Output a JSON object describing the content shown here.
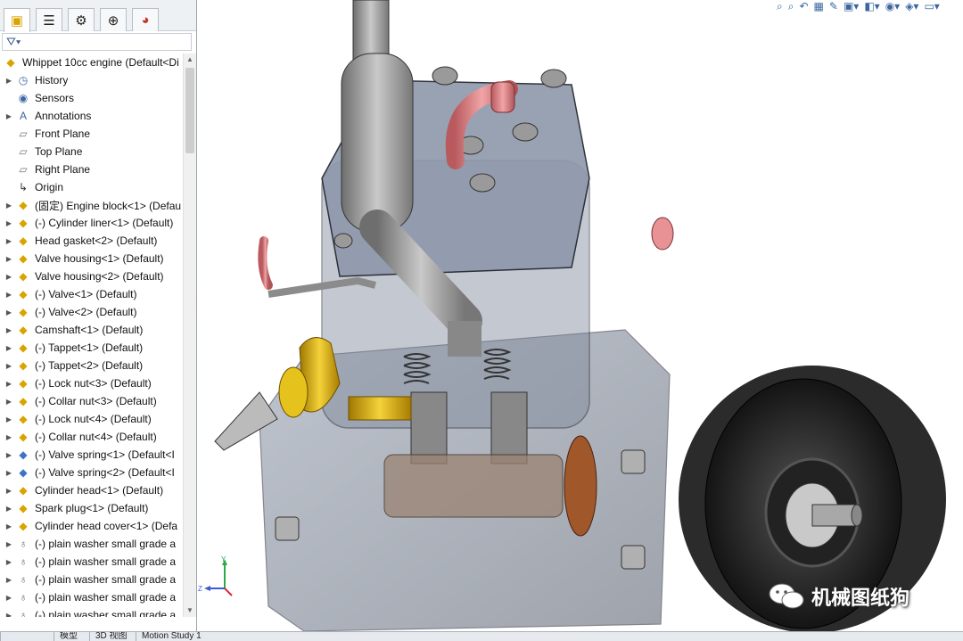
{
  "tabs": [
    {
      "icon": "feature-manager-icon",
      "glyph": "▣"
    },
    {
      "icon": "property-manager-icon",
      "glyph": "☰"
    },
    {
      "icon": "configuration-manager-icon",
      "glyph": "⚙"
    },
    {
      "icon": "dim-xpert-icon",
      "glyph": "⊕"
    },
    {
      "icon": "display-manager-icon",
      "glyph": "◕"
    }
  ],
  "tree": {
    "root": "Whippet 10cc engine  (Default<Di",
    "items": [
      {
        "label": "History",
        "icon": "history-icon",
        "glyph": "◷",
        "expand": true
      },
      {
        "label": "Sensors",
        "icon": "sensors-icon",
        "glyph": "◉",
        "expand": false
      },
      {
        "label": "Annotations",
        "icon": "annotations-icon",
        "glyph": "A",
        "expand": true
      },
      {
        "label": "Front Plane",
        "icon": "plane-icon",
        "glyph": "▱",
        "expand": false
      },
      {
        "label": "Top Plane",
        "icon": "plane-icon",
        "glyph": "▱",
        "expand": false
      },
      {
        "label": "Right Plane",
        "icon": "plane-icon",
        "glyph": "▱",
        "expand": false
      },
      {
        "label": "Origin",
        "icon": "origin-icon",
        "glyph": "↳",
        "expand": false
      },
      {
        "label": "(固定) Engine block<1> (Defau",
        "icon": "part-icon",
        "glyph": "◆",
        "expand": true
      },
      {
        "label": "(-) Cylinder liner<1> (Default)",
        "icon": "part-icon",
        "glyph": "◆",
        "expand": true
      },
      {
        "label": "Head gasket<2> (Default)",
        "icon": "part-icon",
        "glyph": "◆",
        "expand": true
      },
      {
        "label": "Valve housing<1> (Default)",
        "icon": "part-icon",
        "glyph": "◆",
        "expand": true
      },
      {
        "label": "Valve housing<2> (Default)",
        "icon": "part-icon",
        "glyph": "◆",
        "expand": true
      },
      {
        "label": "(-) Valve<1> (Default)",
        "icon": "part-icon",
        "glyph": "◆",
        "expand": true
      },
      {
        "label": "(-) Valve<2> (Default)",
        "icon": "part-icon",
        "glyph": "◆",
        "expand": true
      },
      {
        "label": "Camshaft<1> (Default)",
        "icon": "part-icon",
        "glyph": "◆",
        "expand": true
      },
      {
        "label": "(-) Tappet<1> (Default)",
        "icon": "part-icon",
        "glyph": "◆",
        "expand": true
      },
      {
        "label": "(-) Tappet<2> (Default)",
        "icon": "part-icon",
        "glyph": "◆",
        "expand": true
      },
      {
        "label": "(-) Lock nut<3> (Default)",
        "icon": "part-icon",
        "glyph": "◆",
        "expand": true
      },
      {
        "label": "(-) Collar nut<3> (Default)",
        "icon": "part-icon",
        "glyph": "◆",
        "expand": true
      },
      {
        "label": "(-) Lock nut<4> (Default)",
        "icon": "part-icon",
        "glyph": "◆",
        "expand": true
      },
      {
        "label": "(-) Collar nut<4> (Default)",
        "icon": "part-icon",
        "glyph": "◆",
        "expand": true
      },
      {
        "label": "(-) Valve spring<1> (Default<I",
        "icon": "spring-part-icon",
        "glyph": "◆",
        "expand": true
      },
      {
        "label": "(-) Valve spring<2> (Default<I",
        "icon": "spring-part-icon",
        "glyph": "◆",
        "expand": true
      },
      {
        "label": "Cylinder head<1> (Default)",
        "icon": "part-icon",
        "glyph": "◆",
        "expand": true
      },
      {
        "label": "Spark plug<1> (Default)",
        "icon": "part-icon",
        "glyph": "◆",
        "expand": true
      },
      {
        "label": "Cylinder head cover<1> (Defa",
        "icon": "part-icon",
        "glyph": "◆",
        "expand": true
      },
      {
        "label": "(-) plain washer small grade a",
        "icon": "toolbox-part-icon",
        "glyph": "♁",
        "expand": true
      },
      {
        "label": "(-) plain washer small grade a",
        "icon": "toolbox-part-icon",
        "glyph": "♁",
        "expand": true
      },
      {
        "label": "(-) plain washer small grade a",
        "icon": "toolbox-part-icon",
        "glyph": "♁",
        "expand": true
      },
      {
        "label": "(-) plain washer small grade a",
        "icon": "toolbox-part-icon",
        "glyph": "♁",
        "expand": true
      },
      {
        "label": "(-) plain washer small grade a",
        "icon": "toolbox-part-icon",
        "glyph": "♁",
        "expand": true
      }
    ]
  },
  "bottom_tabs": [
    "",
    "模型",
    "3D 视图",
    "Motion Study 1"
  ],
  "watermark": "机械图纸狗",
  "triad": {
    "y": "Y",
    "z": "Z"
  },
  "colors": {
    "accent": "#3b66a0",
    "part_yellow": "#e8b400",
    "part_blue": "#3f73c4"
  }
}
